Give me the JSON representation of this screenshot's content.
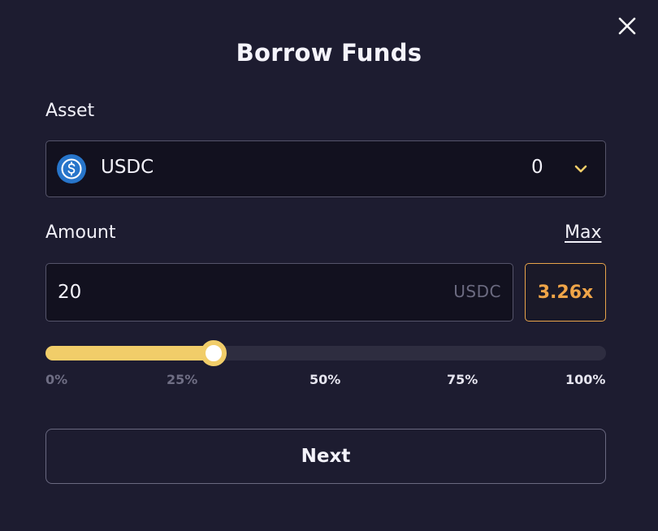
{
  "modal": {
    "title": "Borrow Funds",
    "close_icon": "close-icon"
  },
  "asset": {
    "label": "Asset",
    "selected": "USDC",
    "balance": "0",
    "icon": "usdc-icon",
    "dropdown_icon": "chevron-down-icon"
  },
  "amount": {
    "label": "Amount",
    "max_label": "Max",
    "value": "20",
    "unit": "USDC",
    "leverage": "3.26x"
  },
  "slider": {
    "percent": 30,
    "ticks": [
      "0%",
      "25%",
      "50%",
      "75%",
      "100%"
    ]
  },
  "actions": {
    "next_label": "Next"
  },
  "colors": {
    "background": "#1d1c30",
    "accent_yellow": "#f1cd69",
    "leverage_orange": "#f0a548",
    "usdc_blue": "#2775ca"
  }
}
